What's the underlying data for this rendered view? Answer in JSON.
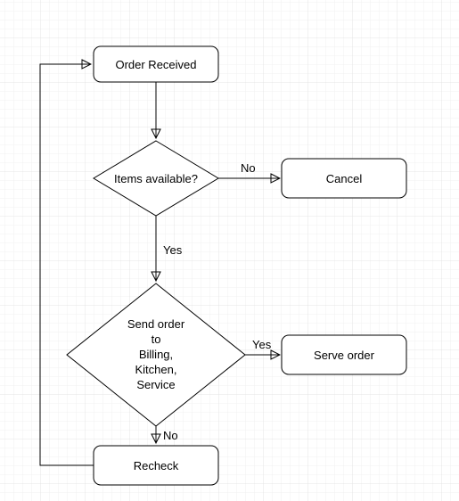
{
  "nodes": {
    "order_received": {
      "label": "Order Received"
    },
    "items_available": {
      "label": "Items available?"
    },
    "cancel": {
      "label": "Cancel"
    },
    "send_order": {
      "l1": "Send order",
      "l2": "to",
      "l3": "Billing,",
      "l4": "Kitchen,",
      "l5": "Service"
    },
    "serve_order": {
      "label": "Serve order"
    },
    "recheck": {
      "label": "Recheck"
    }
  },
  "edges": {
    "items_no": "No",
    "items_yes": "Yes",
    "send_yes": "Yes",
    "send_no": "No"
  }
}
